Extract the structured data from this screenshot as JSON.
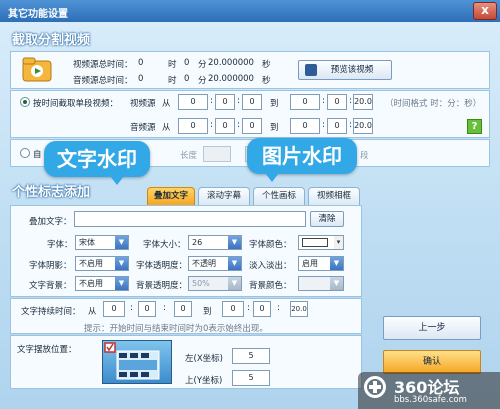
{
  "window": {
    "title": "其它功能设置",
    "close": "x"
  },
  "split": {
    "title": "截取分割视频",
    "video_total_label": "视频源总时间：",
    "audio_total_label": "音频源总时间：",
    "video_total": {
      "h": "0",
      "h_unit": "时",
      "m": "0",
      "m_unit": "分",
      "s": "20.000000",
      "s_unit": "秒"
    },
    "audio_total": {
      "h": "0",
      "h_unit": "时",
      "m": "0",
      "m_unit": "分",
      "s": "20.000000",
      "s_unit": "秒"
    },
    "preview_button": "预览该视频",
    "by_time_label": "按时间截取单段视频：",
    "video_src": "视频源",
    "audio_src": "音频源",
    "from": "从",
    "to": "到",
    "video_from": [
      "0",
      "0",
      "0"
    ],
    "video_to": [
      "0",
      "0",
      "20.0"
    ],
    "audio_from": [
      "0",
      "0",
      "0"
    ],
    "audio_to": [
      "0",
      "0",
      "20.0"
    ],
    "time_format": "（时间格式 时：分：秒）",
    "help": "?",
    "second_radio_partial": "自",
    "length_partial": "长度",
    "seg_partial": "段"
  },
  "bubbles": {
    "text_watermark": "文字水印",
    "image_watermark": "图片水印"
  },
  "logo": {
    "title": "个性标志添加",
    "tabs": [
      "叠加文字",
      "滚动字幕",
      "个性画标",
      "视频相框"
    ],
    "text_label": "叠加文字：",
    "clear_button": "清除",
    "font_label": "字体：",
    "font_value": "宋体",
    "size_label": "字体大小：",
    "size_value": "26",
    "color_label": "字体颜色：",
    "shadow_label": "字体阴影：",
    "shadow_value": "不启用",
    "opacity_label": "字体透明度：",
    "opacity_value": "不透明",
    "fade_label": "淡入淡出：",
    "fade_value": "启用",
    "bg_label": "文字背景：",
    "bg_value": "不启用",
    "bg_opacity_label": "背景透明度：",
    "bg_opacity_value": "50%",
    "bg_color_label": "背景颜色：",
    "duration_label": "文字持续时间：",
    "from": "从",
    "to": "到",
    "dur_from": [
      "0",
      "0",
      "0"
    ],
    "dur_to": [
      "0",
      "0",
      "20.0"
    ],
    "hint": "提示：开始时间与结束时间时为0表示始终出现。",
    "position_label": "文字摆放位置：",
    "left_label": "左(X坐标)",
    "left_value": "5",
    "top_label": "上(Y坐标)",
    "top_value": "5"
  },
  "buttons": {
    "prev": "上一步",
    "ok": "确认"
  },
  "watermark": {
    "brand": "360论坛",
    "url": "bbs.360safe.com"
  },
  "colors": {
    "accent": "#f5a623",
    "bubble": "#32a9e6",
    "title": "#2d6fb8"
  }
}
